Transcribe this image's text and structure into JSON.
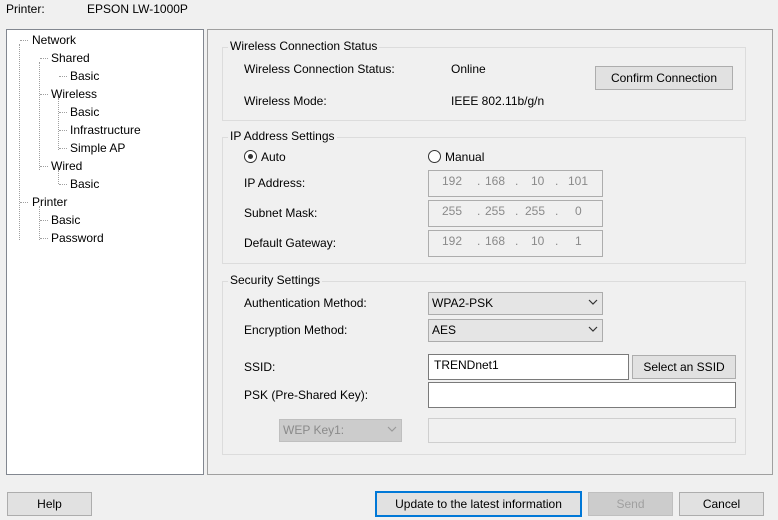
{
  "header": {
    "printer_label": "Printer:",
    "printer_name": "EPSON LW-1000P"
  },
  "tree": {
    "network": "Network",
    "shared": "Shared",
    "shared_basic": "Basic",
    "wireless": "Wireless",
    "wireless_basic": "Basic",
    "infrastructure": "Infrastructure",
    "simple_ap": "Simple AP",
    "wired": "Wired",
    "wired_basic": "Basic",
    "printer": "Printer",
    "printer_basic": "Basic",
    "password": "Password"
  },
  "wireless_status": {
    "group_title": "Wireless Connection Status",
    "status_label": "Wireless Connection Status:",
    "status_value": "Online",
    "mode_label": "Wireless Mode:",
    "mode_value": "IEEE 802.11b/g/n",
    "confirm_button": "Confirm Connection"
  },
  "ip_settings": {
    "group_title": "IP Address Settings",
    "auto_label": "Auto",
    "manual_label": "Manual",
    "selected_mode": "Auto",
    "ip_label": "IP Address:",
    "ip": [
      "192",
      "168",
      "10",
      "101"
    ],
    "subnet_label": "Subnet Mask:",
    "subnet": [
      "255",
      "255",
      "255",
      "0"
    ],
    "gateway_label": "Default Gateway:",
    "gateway": [
      "192",
      "168",
      "10",
      "1"
    ],
    "separator": "."
  },
  "security": {
    "group_title": "Security Settings",
    "auth_label": "Authentication Method:",
    "auth_value": "WPA2-PSK",
    "enc_label": "Encryption Method:",
    "enc_value": "AES",
    "ssid_label": "SSID:",
    "ssid_value": "TRENDnet1",
    "select_ssid_button": "Select an SSID",
    "psk_label": "PSK (Pre-Shared Key):",
    "psk_value": "",
    "wep_key_value": "WEP Key1:",
    "wep_value": ""
  },
  "footer": {
    "help": "Help",
    "update": "Update to the latest information",
    "send": "Send",
    "cancel": "Cancel"
  }
}
